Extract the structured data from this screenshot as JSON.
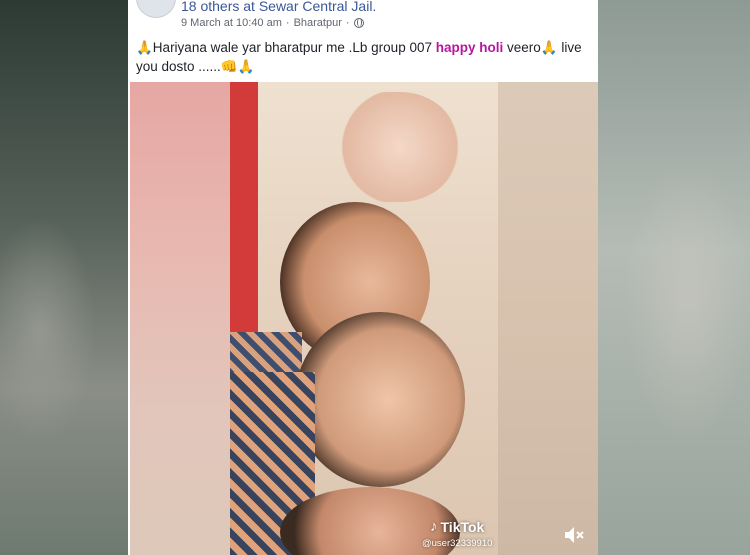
{
  "post": {
    "tagged_text": "18 others at Sewar Central Jail.",
    "date": "9 March at 10:40 am",
    "separator": "·",
    "location": "Bharatpur",
    "text_part1": "🙏Hariyana wale yar bharatpur me .Lb group 007 ",
    "text_highlight": "happy holi",
    "text_part2": " veero🙏 live you dosto ......👊🙏"
  },
  "video": {
    "watermark_brand": "TikTok",
    "watermark_user": "@user32339910",
    "mute_icon": "speaker-muted-icon"
  },
  "colors": {
    "link": "#385898",
    "highlight": "#b5179e",
    "meta": "#616770"
  }
}
